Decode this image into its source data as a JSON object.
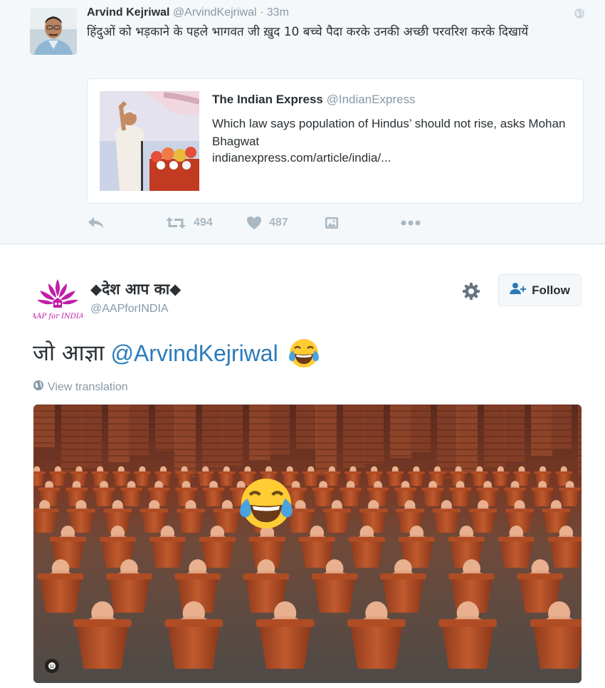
{
  "top_tweet": {
    "author_name": "Arvind Kejriwal",
    "author_handle": "@ArvindKejriwal",
    "separator": "·",
    "time": "33m",
    "text": "हिंदुओं को भड़काने के पहले भागवत जी ख़ुद 10 बच्चे पैदा करके उनकी अच्छी परवरिश करके दिखायें",
    "quote": {
      "name": "The Indian Express",
      "handle": "@IndianExpress",
      "text": "Which law says population of Hindus’ should not rise, asks Mohan Bhagwat",
      "link": "indianexpress.com/article/india/..."
    },
    "actions": {
      "reply_icon": "reply-icon",
      "retweet_icon": "retweet-icon",
      "retweet_count": "494",
      "like_icon": "heart-icon",
      "like_count": "487",
      "media_icon": "photo-icon",
      "more_icon": "more-icon"
    }
  },
  "bottom_tweet": {
    "author_name": "◆देश आप का◆",
    "author_handle": "@AAPforINDIA",
    "avatar_logo_text": "AAP for INDIA",
    "follow_label": "Follow",
    "text_hindi": "जो आज्ञा",
    "mention": "@ArvindKejriwal",
    "emoji": "face-with-tears-of-joy",
    "view_translation": "View translation"
  },
  "colors": {
    "link_blue": "#2b7bb9",
    "muted": "#8899a6",
    "icon_gray": "#aab8c2",
    "top_bg": "#f5f8fa",
    "emoji_yellow": "#ffcc33"
  }
}
